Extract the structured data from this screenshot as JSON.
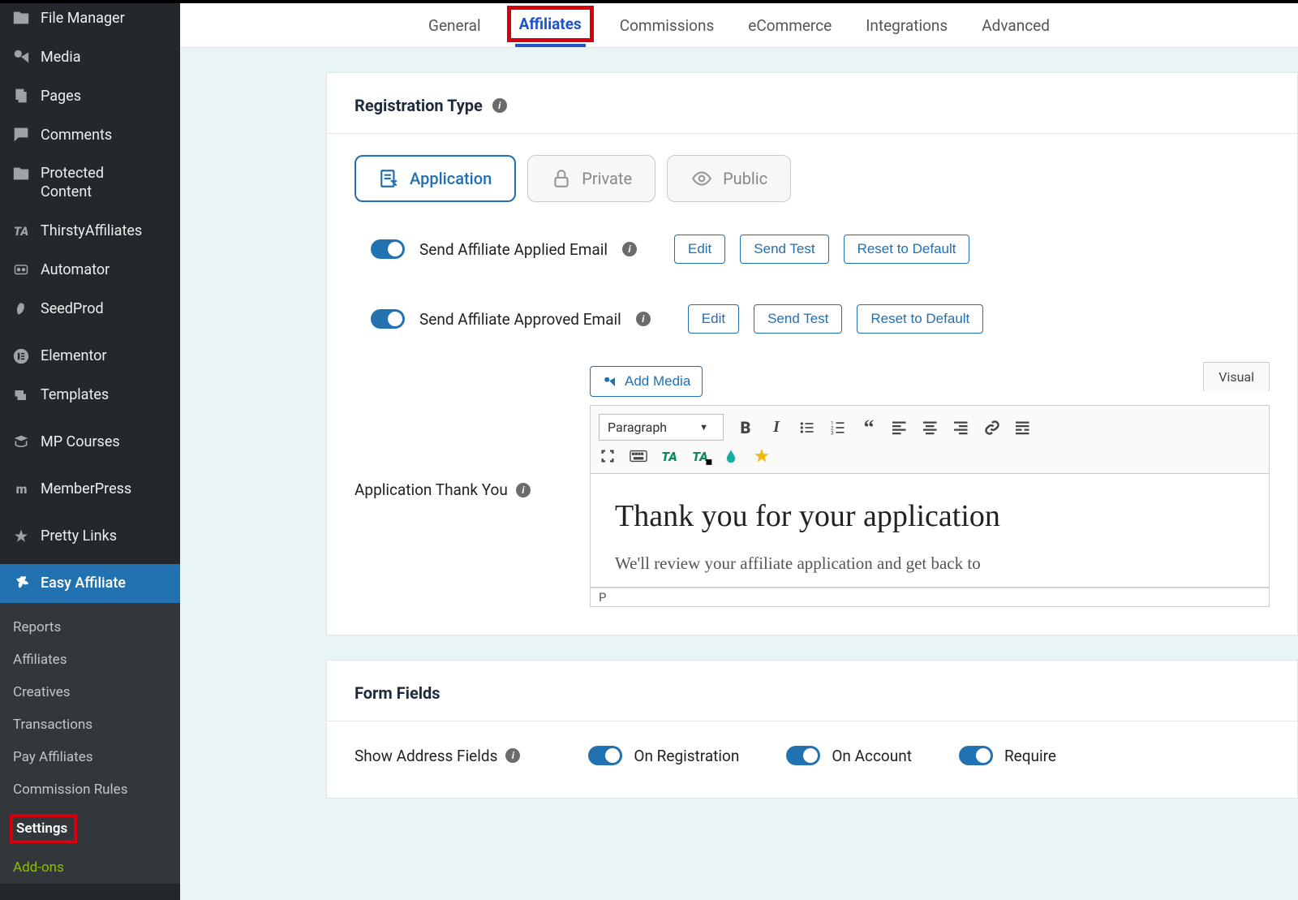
{
  "sidebar": {
    "items": [
      {
        "label": "File Manager"
      },
      {
        "label": "Media"
      },
      {
        "label": "Pages"
      },
      {
        "label": "Comments"
      },
      {
        "label": "Protected Content"
      },
      {
        "label": "ThirstyAffiliates"
      },
      {
        "label": "Automator"
      },
      {
        "label": "SeedProd"
      },
      {
        "label": "Elementor"
      },
      {
        "label": "Templates"
      },
      {
        "label": "MP Courses"
      },
      {
        "label": "MemberPress"
      },
      {
        "label": "Pretty Links"
      },
      {
        "label": "Easy Affiliate"
      }
    ],
    "subitems": [
      {
        "label": "Reports"
      },
      {
        "label": "Affiliates"
      },
      {
        "label": "Creatives"
      },
      {
        "label": "Transactions"
      },
      {
        "label": "Pay Affiliates"
      },
      {
        "label": "Commission Rules"
      },
      {
        "label": "Settings"
      },
      {
        "label": "Add-ons"
      }
    ]
  },
  "tabs": [
    "General",
    "Affiliates",
    "Commissions",
    "eCommerce",
    "Integrations",
    "Advanced"
  ],
  "section1": {
    "title": "Registration Type",
    "types": [
      {
        "label": "Application"
      },
      {
        "label": "Private"
      },
      {
        "label": "Public"
      }
    ],
    "toggle1": {
      "label": "Send Affiliate Applied Email",
      "edit": "Edit",
      "test": "Send Test",
      "reset": "Reset to Default"
    },
    "toggle2": {
      "label": "Send Affiliate Approved Email",
      "edit": "Edit",
      "test": "Send Test",
      "reset": "Reset to Default"
    },
    "editor": {
      "label": "Application Thank You",
      "addmedia": "Add Media",
      "visual": "Visual",
      "parsel": "Paragraph",
      "heading": "Thank you for your application",
      "body": "We'll review your affiliate application and get back to",
      "status": "P"
    }
  },
  "section2": {
    "title": "Form Fields",
    "row1": {
      "label": "Show Address Fields",
      "opts": [
        "On Registration",
        "On Account",
        "Require"
      ]
    }
  }
}
